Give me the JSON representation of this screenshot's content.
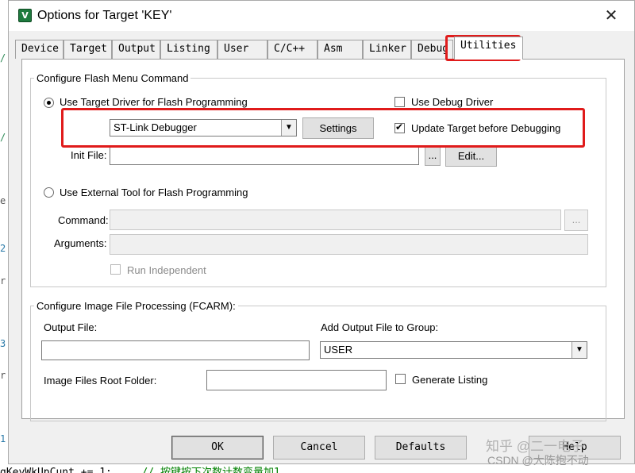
{
  "background_editor": {
    "left_markers": [
      "/",
      "/",
      "e",
      "2",
      "r",
      "3",
      "r",
      "1"
    ],
    "code_line": "gKeyWkUpCunt += 1;",
    "code_comment": "// 按键按下次数计数变量加1"
  },
  "dialog": {
    "app_icon_glyph": "V",
    "title": "Options for Target 'KEY'",
    "close_glyph": "✕"
  },
  "tabs": [
    {
      "label": "Device"
    },
    {
      "label": "Target"
    },
    {
      "label": "Output"
    },
    {
      "label": "Listing"
    },
    {
      "label": "User"
    },
    {
      "label": "C/C++"
    },
    {
      "label": "Asm"
    },
    {
      "label": "Linker"
    },
    {
      "label": "Debug"
    },
    {
      "label": "Utilities",
      "active": true
    }
  ],
  "flash_group": {
    "title": "Configure Flash Menu Command",
    "use_target_driver": {
      "label": "Use Target Driver for Flash Programming",
      "selected": true
    },
    "use_debug_driver": {
      "label": "Use Debug Driver",
      "checked": false
    },
    "driver_select": {
      "value": "ST-Link Debugger"
    },
    "settings_button": "Settings",
    "update_target": {
      "label": "Update Target before Debugging",
      "checked": true
    },
    "init_file": {
      "label": "Init File:",
      "value": ""
    },
    "browse_button": "...",
    "edit_button": "Edit...",
    "use_external_tool": {
      "label": "Use External Tool for Flash Programming",
      "selected": false
    },
    "command": {
      "label": "Command:",
      "value": ""
    },
    "command_browse": "...",
    "arguments": {
      "label": "Arguments:",
      "value": ""
    },
    "run_independent": {
      "label": "Run Independent",
      "checked": false
    }
  },
  "image_group": {
    "title": "Configure Image File Processing (FCARM):",
    "output_file": {
      "label": "Output File:",
      "value": ""
    },
    "add_output": {
      "label": "Add Output File  to Group:",
      "value": "USER"
    },
    "root_folder": {
      "label": "Image Files Root Folder:",
      "value": ""
    },
    "generate_listing": {
      "label": "Generate Listing",
      "checked": false
    }
  },
  "buttons": {
    "ok": "OK",
    "cancel": "Cancel",
    "defaults": "Defaults",
    "help": "Help"
  },
  "watermark": {
    "line1": "知乎 @二一电子",
    "line2": "CSDN @大陈抱不动"
  },
  "colors": {
    "highlight": "#e01b1b",
    "dialog_bg": "#f0f0f0",
    "panel_bg": "#ffffff"
  }
}
